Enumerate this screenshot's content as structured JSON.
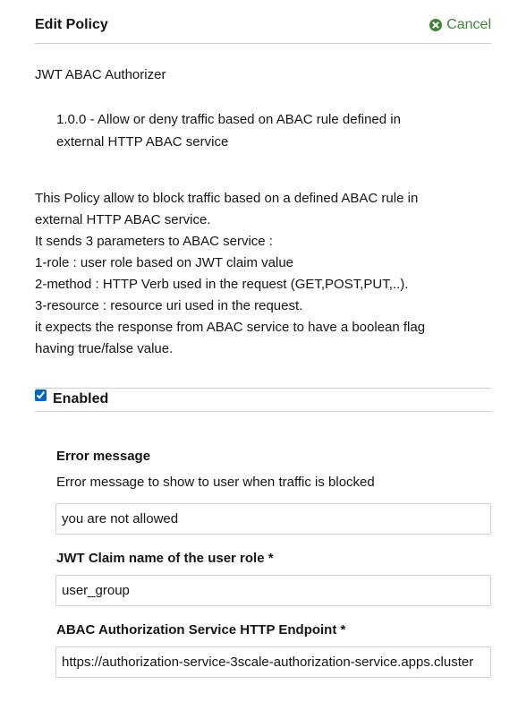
{
  "header": {
    "title": "Edit Policy",
    "cancel_label": "Cancel",
    "cancel_icon": "times-circle-icon",
    "accent_color": "#3e8635"
  },
  "policy": {
    "name": "JWT ABAC Authorizer",
    "summary": "1.0.0 - Allow or deny traffic based on ABAC rule defined in external HTTP ABAC service",
    "description_lines": [
      "This Policy allow to block traffic based on a defined ABAC rule in",
      "external HTTP ABAC service.",
      "It sends 3 parameters to ABAC service :",
      "1-role : user role based on JWT claim value",
      "2-method : HTTP Verb used in the request (GET,POST,PUT,..).",
      "3-resource : resource uri used in the request.",
      "it expects the response from ABAC service to have a boolean flag",
      "having true/false value."
    ]
  },
  "enabled": {
    "label": "Enabled",
    "checked": true
  },
  "fields": [
    {
      "label": "Error message",
      "help": "Error message to show to user when traffic is blocked",
      "value": "you are not allowed"
    },
    {
      "label": "JWT Claim name of the user role *",
      "value": "user_group"
    },
    {
      "label": "ABAC Authorization Service HTTP Endpoint *",
      "value": "https://authorization-service-3scale-authorization-service.apps.cluster"
    }
  ]
}
